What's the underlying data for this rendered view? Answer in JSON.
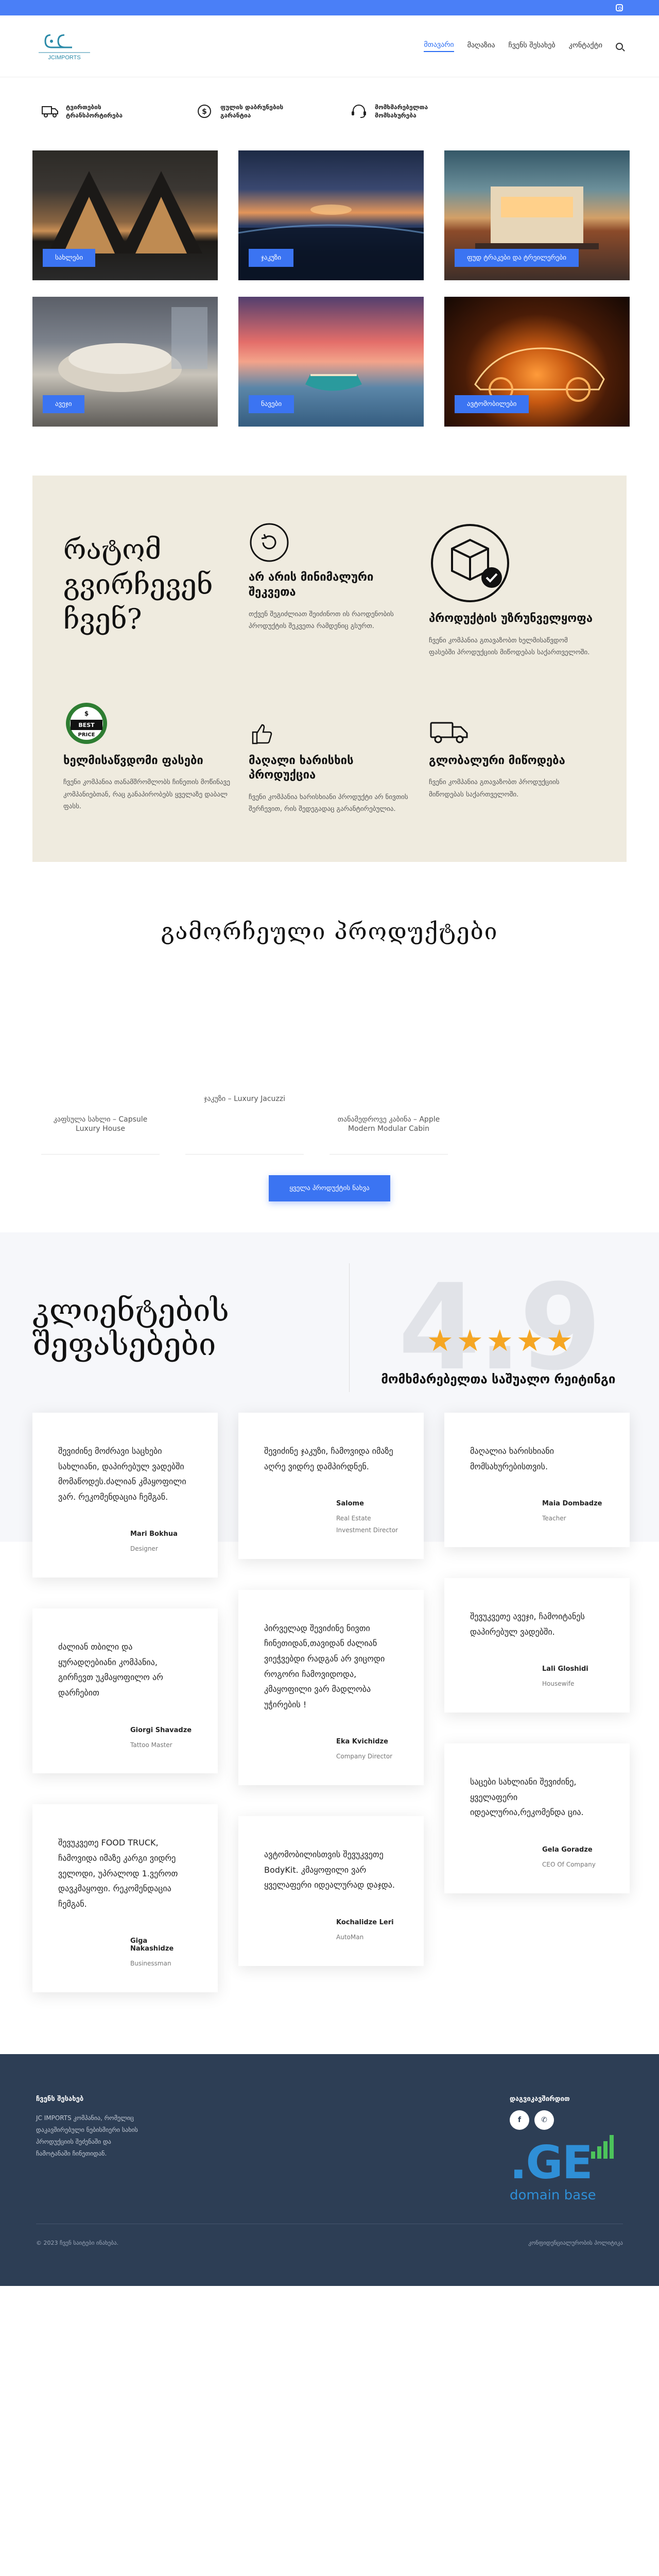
{
  "nav": {
    "logo_text": "JCIMPORTS",
    "items": [
      {
        "label": "მთავარი",
        "active": true
      },
      {
        "label": "მაღაზია",
        "active": false
      },
      {
        "label": "ჩვენს შესახებ",
        "active": false
      },
      {
        "label": "კონტაქტი",
        "active": false
      }
    ],
    "search_icon": "search-icon"
  },
  "features": [
    {
      "icon": "truck-icon",
      "text": "ტვირთების ტრანსპორტირება"
    },
    {
      "icon": "dollar-icon",
      "text": "ფულის დაბრუნების გარანტია"
    },
    {
      "icon": "support-icon",
      "text": "მომხმარებელთა მომსახურება"
    }
  ],
  "gallery": [
    {
      "button": "სახლები"
    },
    {
      "button": "ჯაკუზი"
    },
    {
      "button": "ფუდ ტრაკები და ტრეილერები"
    },
    {
      "button": "ავეჯი"
    },
    {
      "button": "ნავები"
    },
    {
      "button": "ავტომობილები"
    }
  ],
  "why": {
    "title": "რატომ გვირჩევენ ჩვენ?",
    "cards": [
      {
        "icon": "refresh-icon",
        "title": "არ არის მინიმალური შეკვეთა",
        "text": "თქვენ შეგიძლიათ შეიძინოთ ის რაოდენობის პროდუქტის შეკვეთა რამდენიც გსურთ."
      },
      {
        "icon": "box-check-icon",
        "title": "პროდუქტის უზრუნველყოფა",
        "text": "ჩვენი კომპანია გთავაზობთ ხელმისაწვდომ ფასებში პროდუქციის მიწოდებას საქართველოში."
      },
      {
        "icon": "best-price-icon",
        "title": "ხელმისაწვდომი ფასები",
        "text": "ჩვენი კომპანია თანამშრომლობს ჩინეთის მოწინავე კომპანიებთან, რაც განაპირობებს ყველაზე დაბალ ფასს."
      },
      {
        "icon": "thumbs-up-icon",
        "title": "მაღალი ხარისხის პროდუქცია",
        "text": "ჩვენი კომპანია ხარისხიანი პროდუქტი არ ნივთის შერჩევით, რის შედეგადაც გარანტირებულია."
      },
      {
        "icon": "truck-icon",
        "title": "გლობალური მიწოდება",
        "text": "ჩვენი კომპანია გთავაზობთ პროდუქციის მიწოდებას საქართველოში."
      }
    ]
  },
  "featured": {
    "title": "გამორჩეული პროდუქტები",
    "products": [
      "კაფსულა სახლი – Capsule Luxury House",
      "ჯაკუზი – Luxury Jacuzzi",
      "თანამედროვე კაბინა – Apple Modern Modular Cabin"
    ],
    "all_button": "ყველა პროდუქტის ნახვა"
  },
  "reviews": {
    "title": "კლიენტების შეფასებები",
    "score": "4.9",
    "stars": 5,
    "score_label": "მომხმარებელთა საშუალო რეიტინგი",
    "columns": [
      [
        {
          "quote": "შევიძინე მოძრავი საცხები სახლიანი, დაპირებულ ვადებში მომაწოდეს.ძალიან კმაყოფილი ვარ. რეკომენდაცია ჩემგან.",
          "name": "Mari Bokhua",
          "role": "Designer"
        },
        {
          "quote": "ძალიან თბილი და ყურადღებიანი კომპანია, გირჩევთ უკმაყოფილო არ დარჩებით",
          "name": "Giorgi Shavadze",
          "role": "Tattoo Master"
        },
        {
          "quote": "შევუკვეთე FOOD TRUCK, ჩამოვიდა იმაზე კარგი ვიდრე ველოდი, უპრალოდ 1.ვეროთ დავკმაყოფი. რეკომენდაცია ჩემგან.",
          "name": "Giga Nakashidze",
          "role": "Businessman"
        }
      ],
      [
        {
          "quote": "შევიძინე ჯაკუზი, ჩამოვიდა იმაზე აღრე ვიდრე დამპირდნენ.",
          "name": "Salome",
          "role": "Real Estate Investment Director"
        },
        {
          "quote": "პირველად შევიძინე ნივთი ჩინეთიდან,თავიდან ძალიან ვიეჭვებდი რადგან არ ვიცოდი როგორი ჩამოვიდოდა, კმაყოფილი ვარ მადლობა უჭირების !",
          "name": "Eka Kvichidze",
          "role": "Company Director"
        },
        {
          "quote": "ავტომობილისთვის შევუკვეთე BodyKit. კმაყოფილი ვარ ყველაფერი იდეალურად დაჯდა.",
          "name": "Kochalidze Leri",
          "role": "AutoMan"
        }
      ],
      [
        {
          "quote": "მაღალია ხარისხიანი მომსახურებისთვის.",
          "name": "Maia Dombadze",
          "role": "Teacher"
        },
        {
          "quote": "შევუკვეთე ავეჯი, ჩამოიტანეს დაპირებულ ვადებში.",
          "name": "Lali Gloshidi",
          "role": "Housewife"
        },
        {
          "quote": "საცები სახლიანი შევიძინე, ყველაფერი იდეალურია,რეკომენდა ცია.",
          "name": "Gela Goradze",
          "role": "CEO Of Company"
        }
      ]
    ]
  },
  "footer": {
    "about_title": "ჩვენს შესახებ",
    "about_text": "JC IMPORTS კომპანია, რომელიც დაკავშირებული ნებისმიერი სახის პროდუქციის შეძენაში და ჩამოტანაში ჩინეთიდან.",
    "contact_title": "დაგვიკავშირდით",
    "socials": [
      "facebook-icon",
      "whatsapp-icon"
    ],
    "brand_big": ".GE",
    "brand_sub": "domain base",
    "copyright": "© 2023 ჩვენ საიტები ინახება.",
    "policy": "კონფიდენციალურობის პოლიტიკა"
  }
}
